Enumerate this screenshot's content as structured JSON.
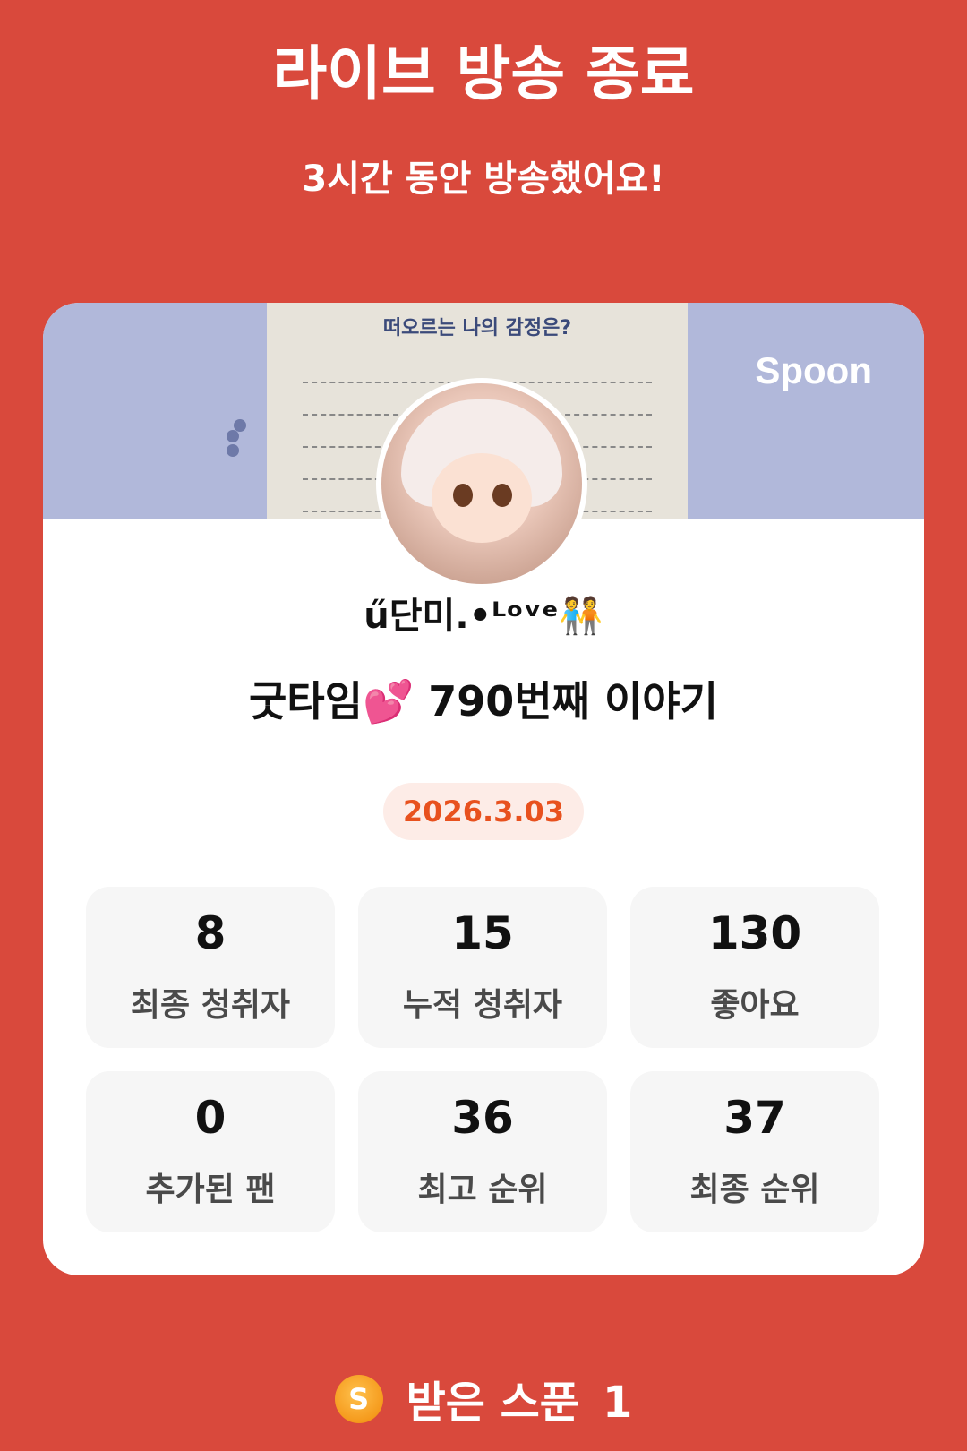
{
  "header": {
    "title": "라이브 방송 종료",
    "subtitle": "3시간 동안 방송했어요!"
  },
  "card": {
    "brand_label": "Spoon",
    "banner_text": "떠오르는 나의 감정은?",
    "nickname": "ű단미.•ᴸᵒᵛᵉ🧑‍🤝‍🧑",
    "live_title": "굿타임💕 790번째 이야기",
    "date": "2026.3.03",
    "stats": [
      {
        "value": "8",
        "label": "최종 청취자"
      },
      {
        "value": "15",
        "label": "누적 청취자"
      },
      {
        "value": "130",
        "label": "좋아요"
      },
      {
        "value": "0",
        "label": "추가된 팬"
      },
      {
        "value": "36",
        "label": "최고 순위"
      },
      {
        "value": "37",
        "label": "최종 순위"
      }
    ]
  },
  "footer": {
    "coin_icon": "spoon-coin-icon",
    "coin_symbol": "S",
    "spoon_label": "받은 스푼",
    "spoon_count": "1"
  },
  "colors": {
    "background": "#D9493C",
    "date_accent": "#E8511E",
    "banner": "#B1B8DA"
  }
}
